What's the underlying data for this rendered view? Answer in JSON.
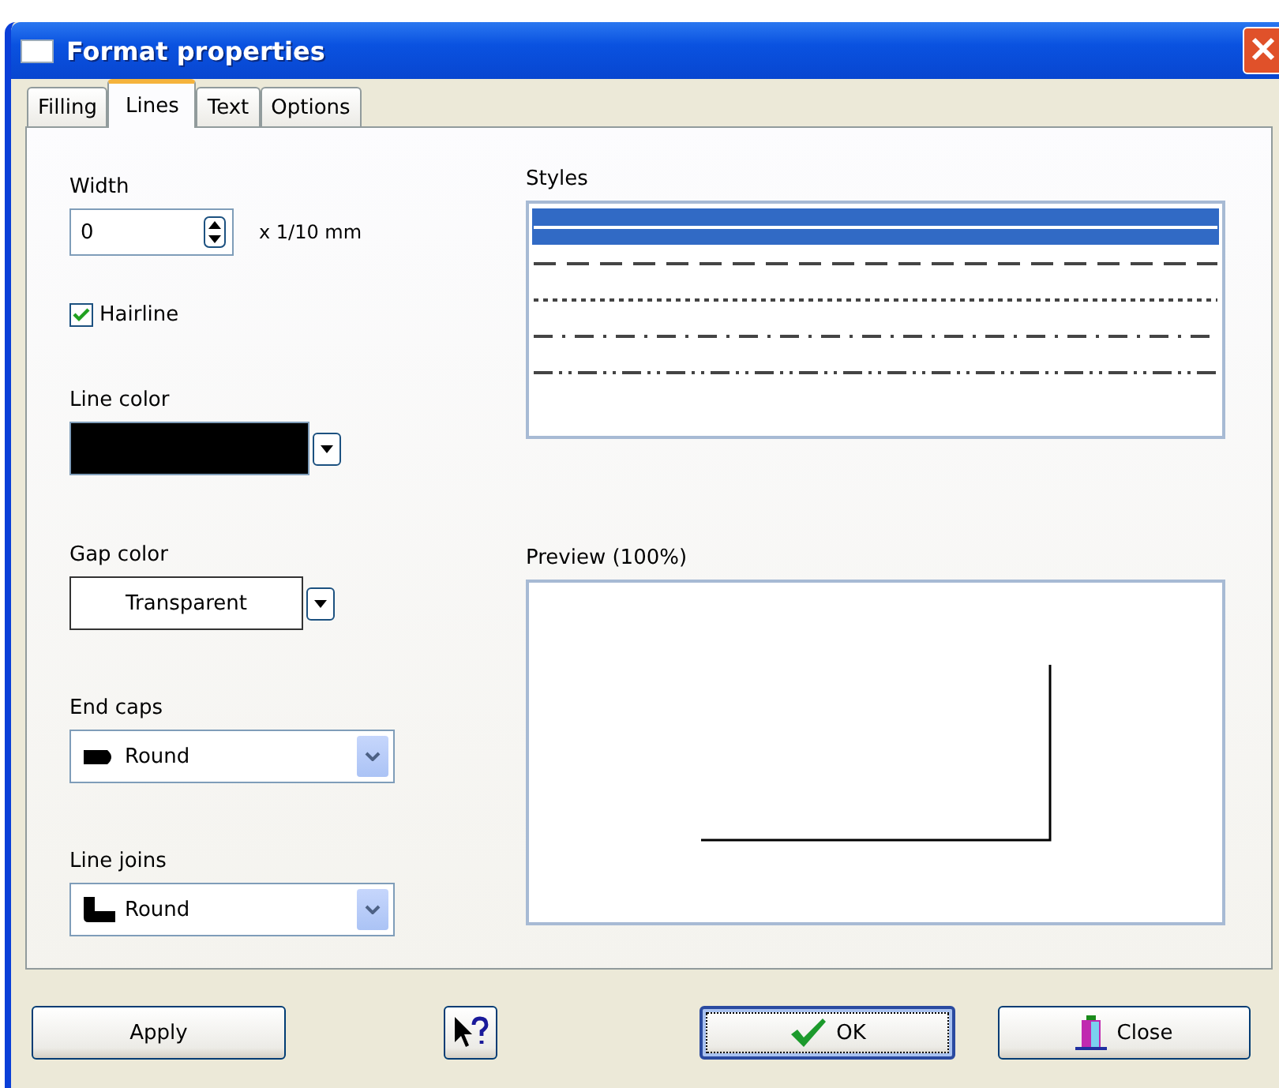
{
  "window": {
    "title": "Format properties"
  },
  "tabs": [
    {
      "label": "Filling",
      "selected": false
    },
    {
      "label": "Lines",
      "selected": true
    },
    {
      "label": "Text",
      "selected": false
    },
    {
      "label": "Options",
      "selected": false
    }
  ],
  "width": {
    "label": "Width",
    "value": "0",
    "unit": "x 1/10 mm"
  },
  "hairline": {
    "label": "Hairline",
    "checked": true
  },
  "line_color": {
    "label": "Line color",
    "color": "#000000"
  },
  "gap_color": {
    "label": "Gap color",
    "value": "Transparent"
  },
  "end_caps": {
    "label": "End caps",
    "value": "Round"
  },
  "line_joins": {
    "label": "Line joins",
    "value": "Round"
  },
  "styles": {
    "label": "Styles",
    "items": [
      {
        "kind": "solid",
        "selected": true
      },
      {
        "kind": "dash",
        "selected": false
      },
      {
        "kind": "dot",
        "selected": false
      },
      {
        "kind": "dashdot",
        "selected": false
      },
      {
        "kind": "dashdotdot",
        "selected": false
      }
    ]
  },
  "preview": {
    "label": "Preview (100%)"
  },
  "buttons": [
    {
      "kind": "apply",
      "label": "Apply",
      "default": false
    },
    {
      "kind": "help",
      "default": false
    },
    {
      "kind": "ok",
      "label": "OK",
      "default": true
    },
    {
      "kind": "close",
      "label": "Close",
      "default": false
    }
  ]
}
